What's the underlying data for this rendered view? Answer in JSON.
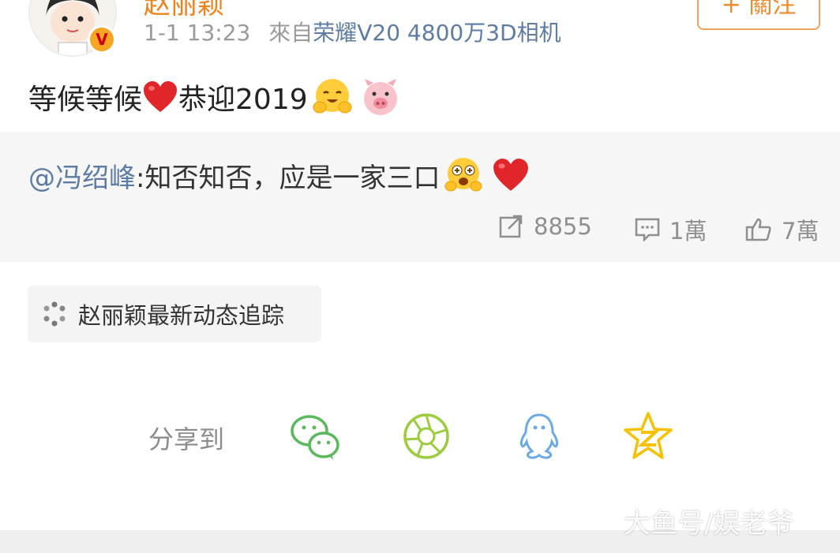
{
  "header": {
    "username": "赵丽颖",
    "time": "1-1 13:23",
    "source_prefix": "來自",
    "source_device": "荣耀V20 4800万3D相机",
    "follow_label": "+ 關注"
  },
  "post": {
    "text_a": "等候等候",
    "text_b": "恭迎2019"
  },
  "repost": {
    "mention": "@冯绍峰",
    "text": ":知否知否，应是一家三口"
  },
  "stats": {
    "reposts": "8855",
    "comments": "1萬",
    "likes": "7萬"
  },
  "tag": {
    "label": "赵丽颖最新动态追踪"
  },
  "share": {
    "label": "分享到",
    "targets": [
      "wechat-icon",
      "moments-icon",
      "qq-icon",
      "qzone-icon"
    ]
  },
  "watermark": "大鱼号/娱老爷",
  "colors": {
    "username": "#f0821e",
    "link": "#5d7ba3",
    "follow": "#f08a2c",
    "wechat": "#5bb85d",
    "moments": "#9ccc3d",
    "qq": "#6aa8e6",
    "qzone": "#f5c100"
  }
}
